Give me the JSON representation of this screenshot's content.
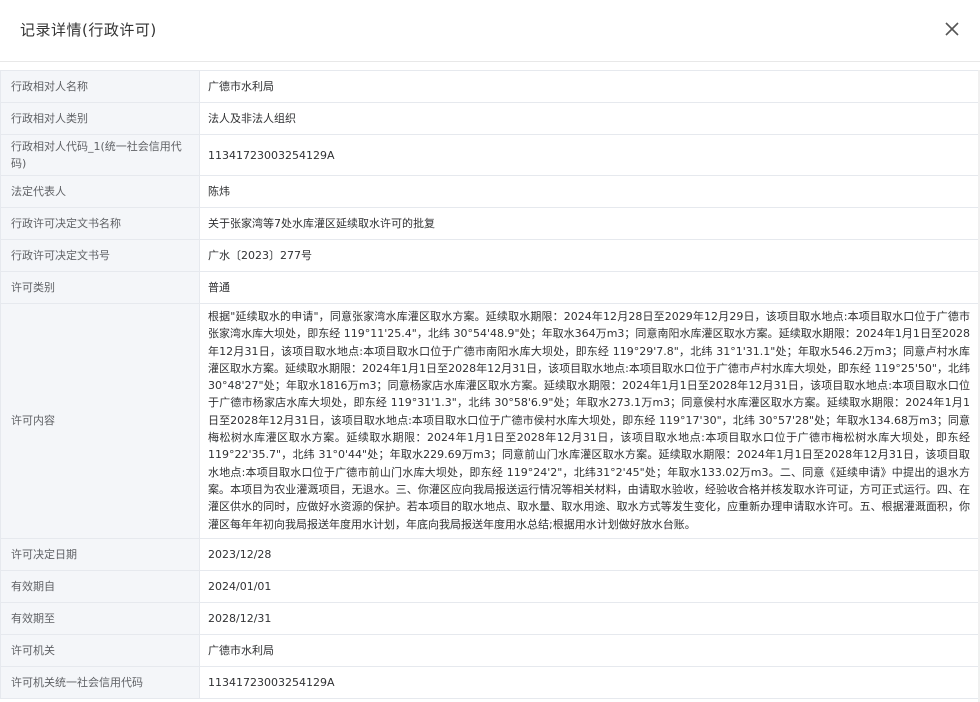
{
  "modal": {
    "title": "记录详情(行政许可)"
  },
  "rows": [
    {
      "label": "行政相对人名称",
      "value": "广德市水利局"
    },
    {
      "label": "行政相对人类别",
      "value": "法人及非法人组织"
    },
    {
      "label": "行政相对人代码_1(统一社会信用代码)",
      "value": "11341723003254129A"
    },
    {
      "label": "法定代表人",
      "value": "陈炜"
    },
    {
      "label": "行政许可决定文书名称",
      "value": "关于张家湾等7处水库灌区延续取水许可的批复"
    },
    {
      "label": "行政许可决定文书号",
      "value": "广水〔2023〕277号"
    },
    {
      "label": "许可类别",
      "value": "普通"
    },
    {
      "label": "许可内容",
      "value": "根据\"延续取水的申请\"，同意张家湾水库灌区取水方案。延续取水期限：2024年12月28日至2029年12月29日，该项目取水地点:本项目取水口位于广德市张家湾水库大坝处，即东经 119°11'25.4\"，北纬 30°54'48.9\"处；年取水364万m3；同意南阳水库灌区取水方案。延续取水期限：2024年1月1日至2028年12月31日，该项目取水地点:本项目取水口位于广德市南阳水库大坝处，即东经 119°29'7.8\"，北纬 31°1'31.1\"处；年取水546.2万m3；同意卢村水库灌区取水方案。延续取水期限：2024年1月1日至2028年12月31日，该项目取水地点:本项目取水口位于广德市卢村水库大坝处，即东经 119°25'50\"，北纬 30°48'27\"处；年取水1816万m3；同意杨家店水库灌区取水方案。延续取水期限：2024年1月1日至2028年12月31日，该项目取水地点:本项目取水口位于广德市杨家店水库大坝处，即东经 119°31'1.3\"，北纬 30°58'6.9\"处；年取水273.1万m3；同意侯村水库灌区取水方案。延续取水期限：2024年1月1日至2028年12月31日，该项目取水地点:本项目取水口位于广德市侯村水库大坝处，即东经 119°17'30\"，北纬 30°57'28\"处；年取水134.68万m3；同意梅松树水库灌区取水方案。延续取水期限：2024年1月1日至2028年12月31日，该项目取水地点:本项目取水口位于广德市梅松树水库大坝处，即东经 119°22'35.7\"，北纬 31°0'44\"处；年取水229.69万m3；同意前山门水库灌区取水方案。延续取水期限：2024年1月1日至2028年12月31日，该项目取水地点:本项目取水口位于广德市前山门水库大坝处，即东经 119°24'2\"，北纬31°2'45\"处；年取水133.02万m3。二、同意《延续申请》中提出的退水方案。本项目为农业灌溉项目，无退水。三、你灌区应向我局报送运行情况等相关材料，由请取水验收，经验收合格并核发取水许可证，方可正式运行。四、在灌区供水的同时，应做好水资源的保护。若本项目的取水地点、取水量、取水用途、取水方式等发生变化，应重新办理申请取水许可。五、根据灌溉面积，你灌区每年年初向我局报送年度用水计划，年底向我局报送年度用水总结;根据用水计划做好放水台账。"
    },
    {
      "label": "许可决定日期",
      "value": "2023/12/28"
    },
    {
      "label": "有效期自",
      "value": "2024/01/01"
    },
    {
      "label": "有效期至",
      "value": "2028/12/31"
    },
    {
      "label": "许可机关",
      "value": "广德市水利局"
    },
    {
      "label": "许可机关统一社会信用代码",
      "value": "11341723003254129A"
    }
  ]
}
